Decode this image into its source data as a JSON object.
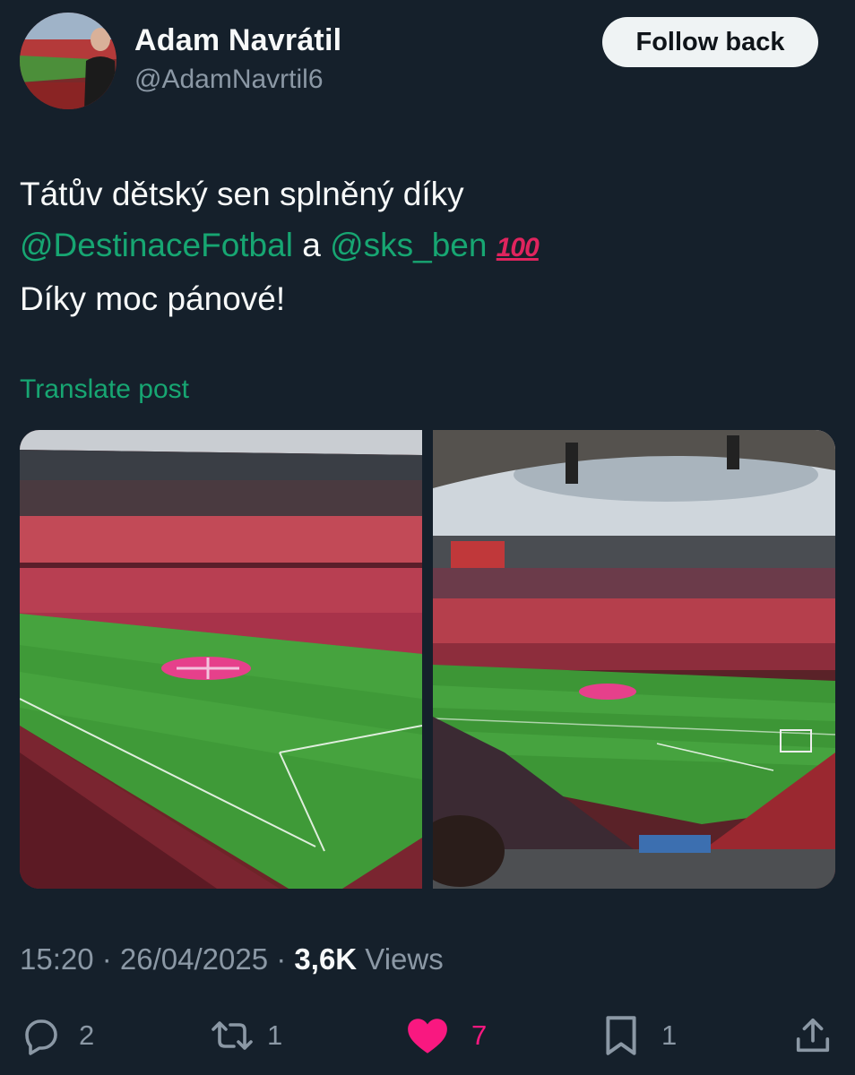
{
  "author": {
    "display_name": "Adam Navrátil",
    "handle": "@AdamNavrtil6"
  },
  "follow_button_label": "Follow back",
  "post": {
    "text_line1": "Tátův dětský sen splněný díky",
    "mention1": "@DestinaceFotbal",
    "connector": " a ",
    "mention2": "@sks_ben",
    "emoji": "100",
    "text_line3": "Díky moc pánové!",
    "translate_label": "Translate post"
  },
  "media": {
    "photos": [
      "stadium-photo-1",
      "stadium-photo-2"
    ]
  },
  "meta": {
    "time": "15:20",
    "separator": " · ",
    "date": "26/04/2025",
    "views_count": "3,6K",
    "views_label": " Views"
  },
  "actions": {
    "reply_count": "2",
    "repost_count": "1",
    "like_count": "7",
    "bookmark_count": "1"
  },
  "colors": {
    "background": "#15202b",
    "accent_green": "#17a672",
    "like_pink": "#f91880",
    "muted_text": "#8b98a5"
  },
  "icons": [
    "reply-icon",
    "repost-icon",
    "heart-icon",
    "bookmark-icon",
    "share-icon"
  ]
}
